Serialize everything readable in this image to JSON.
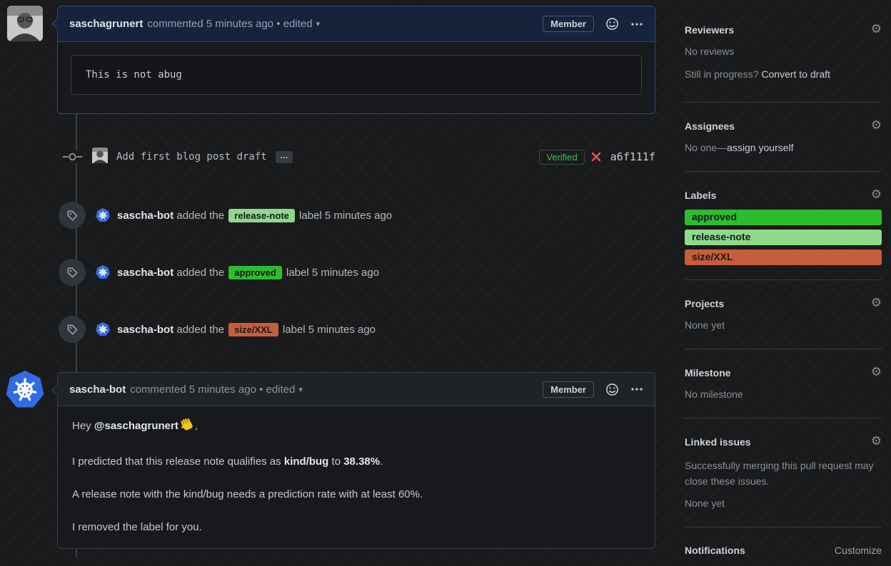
{
  "icons": {
    "caret_down": "▾",
    "gear": "⚙"
  },
  "colors": {
    "comment1_border": "#264d78",
    "comment1_header_bg": "#16233a",
    "label_approved": "#2ebc2e",
    "label_release_note": "#8fd98a",
    "label_size_xxl": "#c65d3c",
    "verified_green": "#41c14c",
    "failed_x_red": "#e5534b",
    "k8s_blue": "#326ce5"
  },
  "comment1": {
    "author": "saschagrunert",
    "meta": "commented 5 minutes ago • edited",
    "member_label": "Member",
    "code_text": "This is not abug"
  },
  "commit": {
    "message": "Add first blog post draft",
    "ellipsis": "…",
    "verified_label": "Verified",
    "hash": "a6f111f"
  },
  "label_events": [
    {
      "actor": "sascha-bot",
      "action": "added the",
      "label": "release-note",
      "suffix": "label 5 minutes ago",
      "color": "#8fd98a"
    },
    {
      "actor": "sascha-bot",
      "action": "added the",
      "label": "approved",
      "suffix": "label 5 minutes ago",
      "color": "#2ebc2e"
    },
    {
      "actor": "sascha-bot",
      "action": "added the",
      "label": "size/XXL",
      "suffix": "label 5 minutes ago",
      "color": "#c65d3c"
    }
  ],
  "comment2": {
    "author": "sascha-bot",
    "meta": "commented 5 minutes ago • edited",
    "member_label": "Member",
    "p1_prefix": "Hey",
    "p1_mention": "@saschagrunert",
    "p1_suffix": ",",
    "p2_prefix": "I predicted that this release note qualifies as",
    "p2_bold1": "kind/bug",
    "p2_mid": "to",
    "p2_bold2": "38.38%",
    "p2_suffix": ".",
    "p3": "A release note with the kind/bug needs a prediction rate with at least 60%.",
    "p4": "I removed the label for you."
  },
  "sidebar": {
    "reviewers": {
      "title": "Reviewers",
      "empty": "No reviews",
      "hint_prefix": "Still in progress?",
      "hint_link": "Convert to draft"
    },
    "assignees": {
      "title": "Assignees",
      "empty_prefix": "No one—",
      "empty_link": "assign yourself"
    },
    "labels": {
      "title": "Labels",
      "items": [
        {
          "name": "approved",
          "color": "#2ebc2e"
        },
        {
          "name": "release-note",
          "color": "#8fd98a"
        },
        {
          "name": "size/XXL",
          "color": "#c65d3c"
        }
      ]
    },
    "projects": {
      "title": "Projects",
      "empty": "None yet"
    },
    "milestone": {
      "title": "Milestone",
      "empty": "No milestone"
    },
    "linked_issues": {
      "title": "Linked issues",
      "description": "Successfully merging this pull request may close these issues.",
      "empty": "None yet"
    },
    "notifications": {
      "title": "Notifications",
      "customize_label": "Customize"
    }
  }
}
